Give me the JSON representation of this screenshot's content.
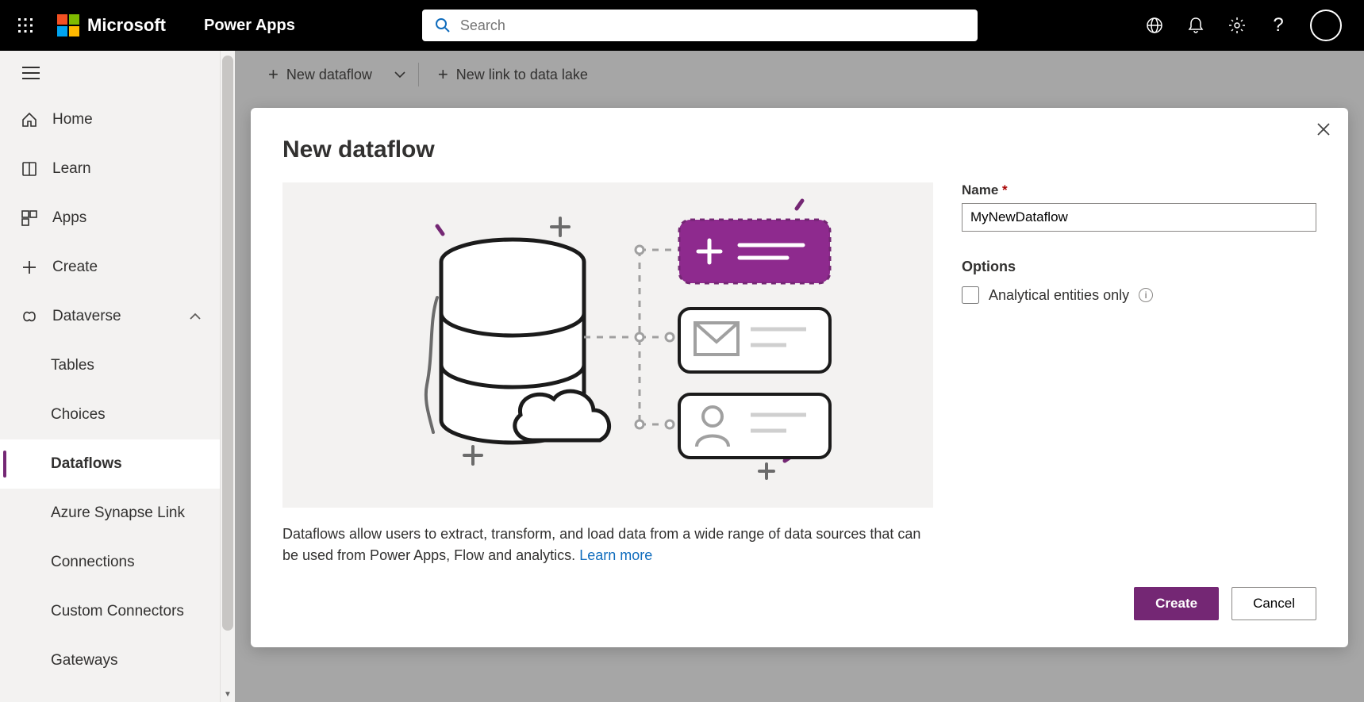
{
  "header": {
    "brand": "Microsoft",
    "product": "Power Apps",
    "search_placeholder": "Search"
  },
  "sidebar": {
    "home": "Home",
    "learn": "Learn",
    "apps": "Apps",
    "create": "Create",
    "dataverse": "Dataverse",
    "tables": "Tables",
    "choices": "Choices",
    "dataflows": "Dataflows",
    "synapse": "Azure Synapse Link",
    "connections": "Connections",
    "custom_connectors": "Custom Connectors",
    "gateways": "Gateways"
  },
  "commandbar": {
    "new_dataflow": "New dataflow",
    "new_link": "New link to data lake"
  },
  "dialog": {
    "title": "New dataflow",
    "description": "Dataflows allow users to extract, transform, and load data from a wide range of data sources that can be used from Power Apps, Flow and analytics. ",
    "learn_more": "Learn more",
    "name_label": "Name",
    "name_value": "MyNewDataflow",
    "options_label": "Options",
    "analytical_label": "Analytical entities only",
    "create": "Create",
    "cancel": "Cancel"
  }
}
